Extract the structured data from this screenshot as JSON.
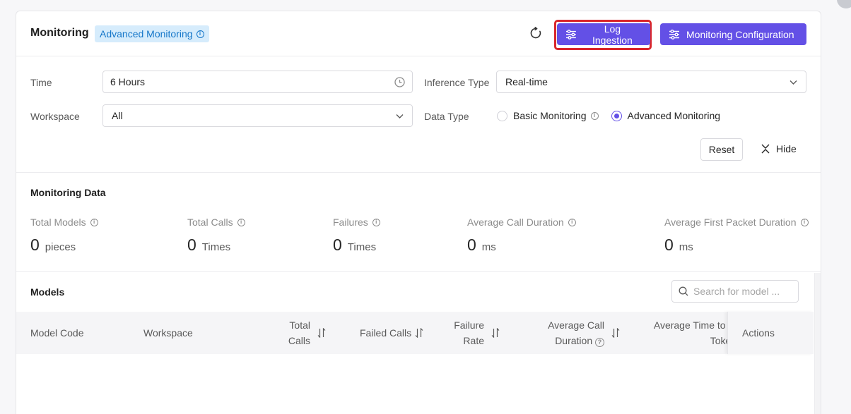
{
  "header": {
    "title": "Monitoring",
    "tag": "Advanced Monitoring",
    "refresh_icon": "refresh-icon",
    "log_ingestion_label": "Log Ingestion",
    "monitoring_config_label": "Monitoring Configuration"
  },
  "filters": {
    "time_label": "Time",
    "time_value": "6 Hours",
    "inference_type_label": "Inference Type",
    "inference_type_value": "Real-time",
    "workspace_label": "Workspace",
    "workspace_value": "All",
    "data_type_label": "Data Type",
    "data_type_options": [
      {
        "label": "Basic Monitoring",
        "selected": false
      },
      {
        "label": "Advanced Monitoring",
        "selected": true
      }
    ],
    "reset_label": "Reset",
    "hide_label": "Hide"
  },
  "monitoring_data": {
    "title": "Monitoring Data",
    "metrics": [
      {
        "label": "Total Models",
        "value": "0",
        "unit": "pieces"
      },
      {
        "label": "Total Calls",
        "value": "0",
        "unit": "Times"
      },
      {
        "label": "Failures",
        "value": "0",
        "unit": "Times"
      },
      {
        "label": "Average Call Duration",
        "value": "0",
        "unit": "ms"
      },
      {
        "label": "Average First Packet Duration",
        "value": "0",
        "unit": "ms"
      }
    ]
  },
  "models": {
    "title": "Models",
    "search_placeholder": "Search for model ...",
    "columns": {
      "model_code": "Model Code",
      "workspace": "Workspace",
      "total_calls_1": "Total",
      "total_calls_2": "Calls",
      "failed_calls": "Failed Calls",
      "failure_rate_1": "Failure",
      "failure_rate_2": "Rate",
      "avg_call_1": "Average Call",
      "avg_call_2": "Duration",
      "avg_time_1": "Average Time to F",
      "avg_time_2": "Toker",
      "actions": "Actions"
    }
  },
  "colors": {
    "primary": "#6350e6",
    "tag_bg": "#d6ecfc",
    "tag_text": "#1677c9",
    "highlight": "#d9262b"
  }
}
